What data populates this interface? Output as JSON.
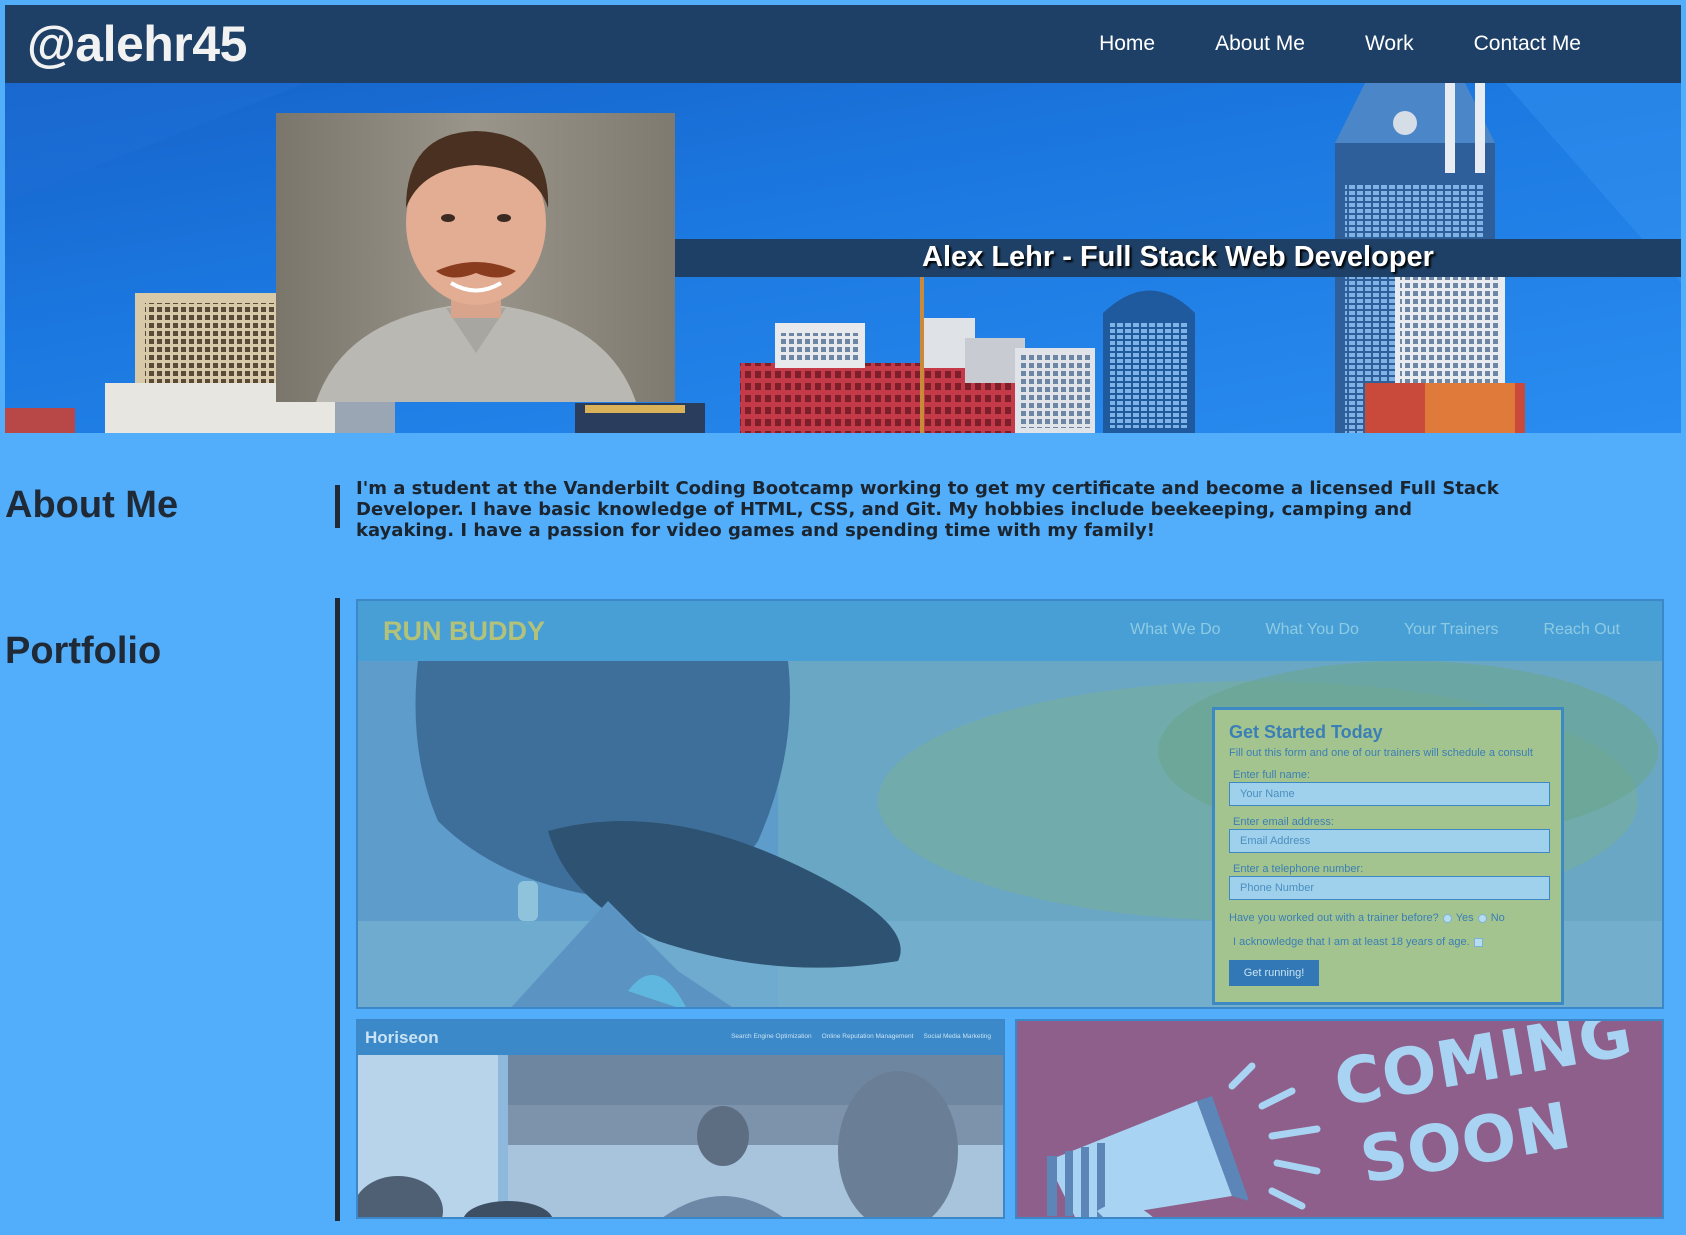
{
  "header": {
    "logo": "@alehr45",
    "nav": [
      "Home",
      "About Me",
      "Work",
      "Contact Me"
    ]
  },
  "hero": {
    "title": "Alex Lehr - Full Stack Web Developer"
  },
  "about": {
    "heading": "About Me",
    "text": "I'm a student at the Vanderbilt Coding Bootcamp working to get my certificate and become a licensed Full Stack Developer. I have basic knowledge of HTML, CSS, and Git. My hobbies include beekeeping, camping and kayaking. I have a passion for video games and spending time with my family!"
  },
  "portfolio": {
    "heading": "Portfolio",
    "run_buddy": {
      "logo": "RUN BUDDY",
      "nav": [
        "What We Do",
        "What You Do",
        "Your Trainers",
        "Reach Out"
      ],
      "form": {
        "title": "Get Started Today",
        "subtitle": "Fill out this form and one of our trainers will schedule a consult",
        "name_label": "Enter full name:",
        "name_placeholder": "Your Name",
        "email_label": "Enter email address:",
        "email_placeholder": "Email Address",
        "phone_label": "Enter a telephone number:",
        "phone_placeholder": "Phone Number",
        "trainer_question": "Have you worked out with a trainer before?",
        "yes": "Yes",
        "no": "No",
        "acknowledge": "I acknowledge that I am at least 18 years of age.",
        "button": "Get running!"
      }
    },
    "horiseon": {
      "logo": "Horiseon",
      "nav": [
        "Search Engine Optimization",
        "Online Reputation Management",
        "Social Media Marketing"
      ]
    },
    "coming_soon": {
      "line1": "COMING",
      "line2": "SOON"
    }
  },
  "colors": {
    "page_bg": "#52adfa",
    "header_bg": "#1f4066",
    "heading_text": "#1f2a36"
  }
}
